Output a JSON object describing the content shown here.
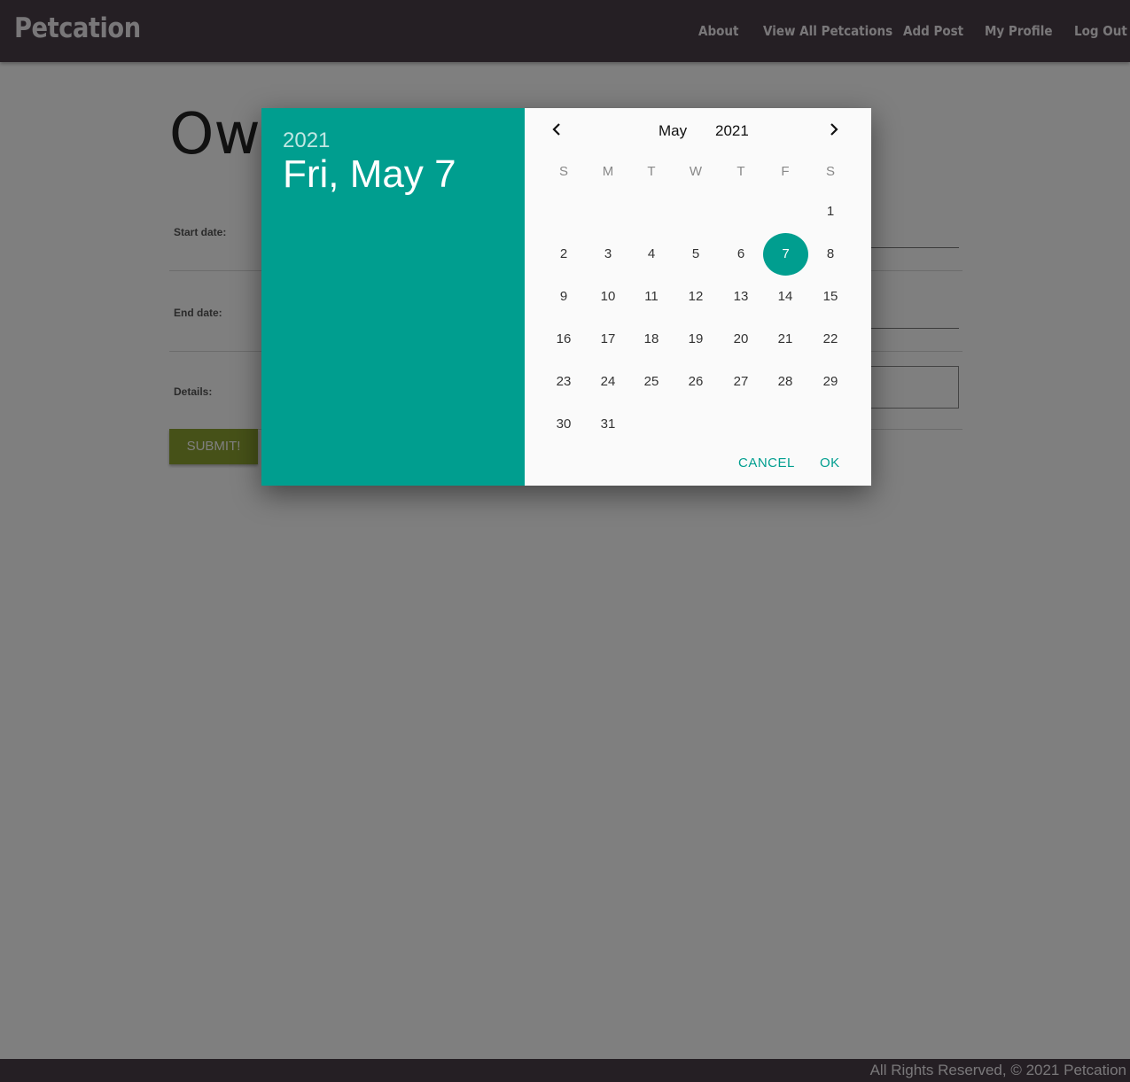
{
  "navbar": {
    "brand": "Petcation",
    "links": [
      "About",
      "View All Petcations",
      "Add Post",
      "My Profile",
      "Log Out"
    ]
  },
  "form": {
    "title": "Ow",
    "start_label": "Start date:",
    "end_label": "End date:",
    "details_label": "Details:",
    "submit_label": "SUBMIT!"
  },
  "footer": {
    "text": "All Rights Reserved, © 2021 Petcation"
  },
  "datepicker": {
    "header_year": "2021",
    "header_date": "Fri, May 7",
    "month": "May",
    "year": "2021",
    "weekdays": [
      "S",
      "M",
      "T",
      "W",
      "T",
      "F",
      "S"
    ],
    "days": [
      "1",
      "2",
      "3",
      "4",
      "5",
      "6",
      "7",
      "8",
      "9",
      "10",
      "11",
      "12",
      "13",
      "14",
      "15",
      "16",
      "17",
      "18",
      "19",
      "20",
      "21",
      "22",
      "23",
      "24",
      "25",
      "26",
      "27",
      "28",
      "29",
      "30",
      "31"
    ],
    "first_weekday_index": 6,
    "selected_day": "7",
    "cancel_label": "CANCEL",
    "ok_label": "OK",
    "accent_color": "#009e8f",
    "prev_icon": "chevron-left-icon",
    "next_icon": "chevron-right-icon"
  },
  "colors": {
    "navbar": "#4a3f49",
    "submit": "#8ca230"
  }
}
